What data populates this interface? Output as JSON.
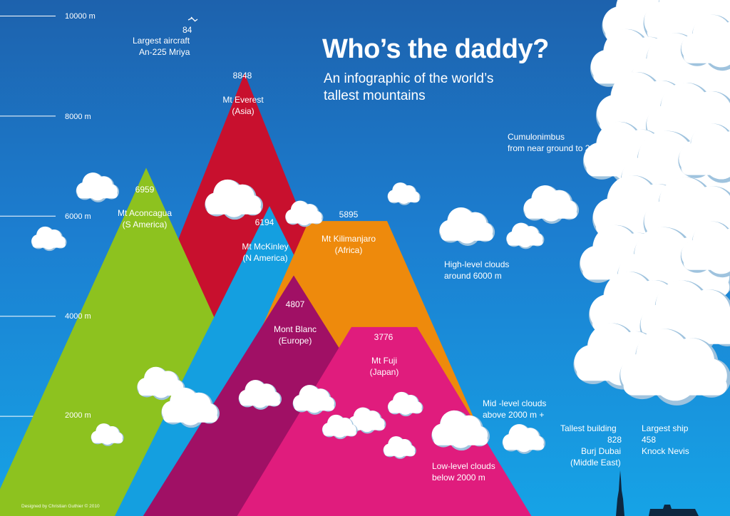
{
  "title": "Who’s the daddy?",
  "subtitle": "An infographic of the world’s tallest mountains",
  "credit": "Designed by Christian Guthier © 2010",
  "axis": {
    "ticks": [
      {
        "value": 2000,
        "label": "2000 m"
      },
      {
        "value": 4000,
        "label": "4000 m"
      },
      {
        "value": 6000,
        "label": "6000 m"
      },
      {
        "value": 8000,
        "label": "8000 m"
      },
      {
        "value": 10000,
        "label": "10000 m"
      }
    ]
  },
  "chart_data": {
    "type": "bar",
    "title": "Who’s the daddy?",
    "subtitle": "An infographic of the world’s tallest mountains",
    "ylabel": "",
    "ylim": [
      0,
      10000
    ],
    "mountains": [
      {
        "name": "Mt Everest",
        "region": "(Asia)",
        "value": 8848,
        "color": "#c8102e"
      },
      {
        "name": "Mt Aconcagua",
        "region": "(S America)",
        "value": 6959,
        "color": "#8dc21f"
      },
      {
        "name": "Mt McKinley",
        "region": "(N America)",
        "value": 6194,
        "color": "#149fe0"
      },
      {
        "name": "Mt Kilimanjaro",
        "region": "(Africa)",
        "value": 5895,
        "color": "#ee8a0c"
      },
      {
        "name": "Mont Blanc",
        "region": "(Europe)",
        "value": 4807,
        "color": "#a01065"
      },
      {
        "name": "Mt Fuji",
        "region": "(Japan)",
        "value": 3776,
        "color": "#e01c7d"
      }
    ],
    "references": [
      {
        "line1": "Largest aircraft",
        "line2": "An-225 Mriya",
        "value": "84"
      },
      {
        "line1": "Tallest building",
        "value": "828",
        "line2": "Burj Dubai",
        "line3": "(Middle East)"
      },
      {
        "line1": "Largest ship",
        "value": "458",
        "line2": "Knock Nevis"
      }
    ],
    "cloud_annotations": [
      {
        "line1": "Cumulonimbus",
        "line2": "from near ground to 20000m"
      },
      {
        "line1": "High-level clouds",
        "line2": "around 6000 m"
      },
      {
        "line1": "Mid -level clouds",
        "line2": "above 2000 m +"
      },
      {
        "line1": "Low-level clouds",
        "line2": "below 2000 m"
      }
    ]
  }
}
